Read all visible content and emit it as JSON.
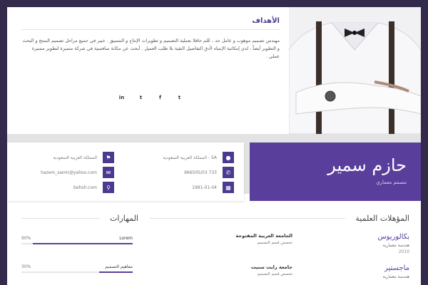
{
  "colors": {
    "accent": "#5a3e9b",
    "frame": "#342a4c"
  },
  "objectives": {
    "title": "الأهداف",
    "text": "مهندس تصميم موهوب و عامل جد ، عُلم حافلا بعملية التصميم و تطويرات الإنتاج و التنسيق . خبير في جميع مراحل تصميم المنتج و البحث و التطوير أيضاً ، لدي إمكانية الإنتباه لأدق التفاصيل النقية بلا طلب العميل . أبحث عن مكانة منافسية في شركة متميزة لتطوير مسيرة عملي ."
  },
  "socials": [
    {
      "icon": "linkedin-icon",
      "glyph": "in"
    },
    {
      "icon": "tumblr-icon",
      "glyph": "t"
    },
    {
      "icon": "facebook-icon",
      "glyph": "f"
    },
    {
      "icon": "twitter-icon",
      "glyph": "t"
    }
  ],
  "contact": {
    "location": "المملكة العربية السعودية - SA",
    "nationality": "المملكة العربية السعودية",
    "phone": "966505/03 733",
    "email": "hazem_samir@yahoo.com",
    "birthdate": "1991-01-04",
    "website": "behsh.com"
  },
  "profile": {
    "name": "حازم سمير",
    "role": "مصمم معماري"
  },
  "skills": {
    "title": "المهارات",
    "items": [
      {
        "name": "Lorem",
        "percent_label": "90%",
        "level": 0.9
      },
      {
        "name": "مفاهيم التصميم",
        "percent_label": "30%",
        "level": 0.3
      }
    ]
  },
  "qualifications": {
    "title": "المؤهلات العلمية",
    "items": [
      {
        "degree": "بكالوريوس",
        "field": "هندسة معمارية",
        "year": "2010",
        "university": "الجامعة العربية المفتوحة",
        "department": "تخصص قسم التصميم"
      },
      {
        "degree": "ماجستير",
        "field": "هندسة معمارية",
        "year": "",
        "university": "جامعة رايت ستيت",
        "department": "تخصص قسم التصميم"
      }
    ]
  }
}
